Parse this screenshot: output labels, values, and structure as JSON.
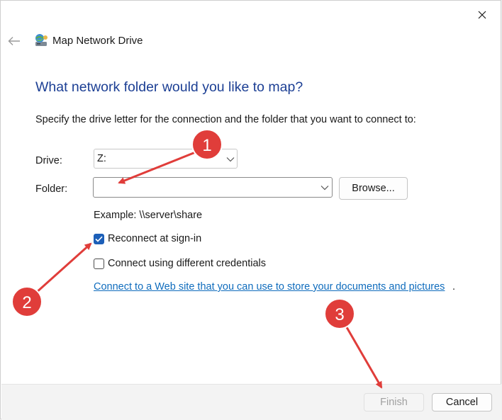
{
  "window": {
    "title": "Map Network Drive",
    "close_icon": "close-icon",
    "back_icon": "back-arrow-icon",
    "title_icon": "network-drive-icon"
  },
  "content": {
    "heading": "What network folder would you like to map?",
    "instruction": "Specify the drive letter for the connection and the folder that you want to connect to:",
    "drive_label": "Drive:",
    "drive_value": "Z:",
    "folder_label": "Folder:",
    "folder_value": "",
    "browse_label": "Browse...",
    "example_text": "Example: \\\\server\\share",
    "reconnect": {
      "label": "Reconnect at sign-in",
      "checked": true
    },
    "credentials": {
      "label": "Connect using different credentials",
      "checked": false
    },
    "link_text": "Connect to a Web site that you can use to store your documents and pictures",
    "link_suffix": "."
  },
  "footer": {
    "finish_label": "Finish",
    "finish_enabled": false,
    "cancel_label": "Cancel"
  },
  "annotations": {
    "markers": [
      "1",
      "2",
      "3"
    ],
    "color": "#e03d3a"
  },
  "colors": {
    "heading": "#1c3f94",
    "link": "#0f6cbd",
    "checkbox_accent": "#1c5fb8"
  }
}
